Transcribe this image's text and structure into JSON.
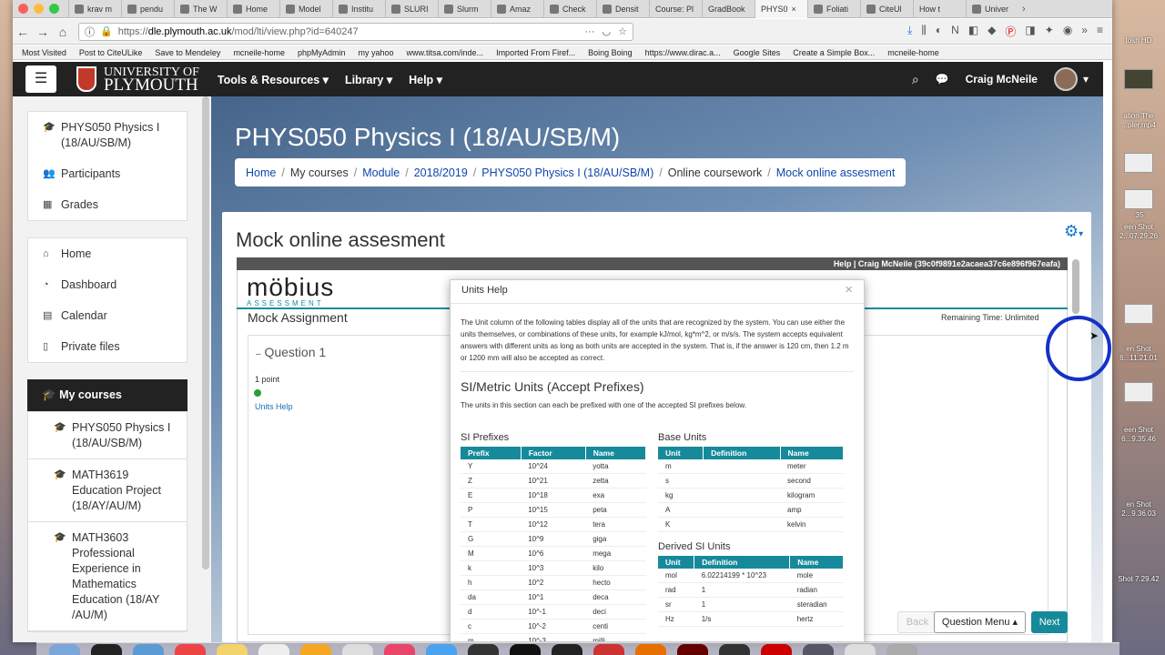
{
  "browser": {
    "tabs": [
      {
        "icon": "bookmark-icon",
        "label": "krav m"
      },
      {
        "icon": "google-icon",
        "label": "pendu"
      },
      {
        "icon": "wordpress-icon",
        "label": "The W"
      },
      {
        "icon": "moodle-icon",
        "label": "Home"
      },
      {
        "icon": "r-icon",
        "label": "Model"
      },
      {
        "icon": "institution-icon",
        "label": "Institu"
      },
      {
        "icon": "slurm-icon",
        "label": "SLURI"
      },
      {
        "icon": "slurm-icon",
        "label": "Slurm"
      },
      {
        "icon": "amazon-icon",
        "label": "Amaz"
      },
      {
        "icon": "check-icon",
        "label": "Check"
      },
      {
        "icon": "density-icon",
        "label": "Densit"
      },
      {
        "icon": "none",
        "label": "Course: Pl"
      },
      {
        "icon": "none",
        "label": "GradBook"
      },
      {
        "icon": "none",
        "label": "PHYS0"
      },
      {
        "icon": "wikipedia-icon",
        "label": "Foliati"
      },
      {
        "icon": "citeulike-icon",
        "label": "CiteUl"
      },
      {
        "icon": "none",
        "label": "How t"
      },
      {
        "icon": "moodle-icon",
        "label": "Univer"
      }
    ],
    "url_prefix": "https://",
    "url_host": "dle.plymouth.ac.uk",
    "url_path": "/mod/lti/view.php?id=640247",
    "bookmarks": [
      "Most Visited",
      "Post to CiteULike",
      "Save to Mendeley",
      "mcneile-home",
      "phpMyAdmin",
      "my yahoo",
      "www.titsa.com/inde...",
      "Imported From Firef...",
      "Boing Boing",
      "https://www.dirac.a...",
      "Google Sites",
      "Create a Simple Box...",
      "mcneile-home"
    ]
  },
  "navbar": {
    "logo_line1": "UNIVERSITY OF",
    "logo_line2": "PLYMOUTH",
    "menus": [
      "Tools & Resources",
      "Library",
      "Help"
    ],
    "user_name": "Craig McNeile"
  },
  "drawer": {
    "course_block": [
      {
        "icon": "graduation-cap-icon",
        "label": "PHYS050 Physics I (18/AU/SB/M)"
      },
      {
        "icon": "users-icon",
        "label": "Participants"
      },
      {
        "icon": "table-icon",
        "label": "Grades"
      }
    ],
    "site_block": [
      {
        "icon": "home-icon",
        "label": "Home"
      },
      {
        "icon": "dashboard-icon",
        "label": "Dashboard"
      },
      {
        "icon": "calendar-icon",
        "label": "Calendar"
      },
      {
        "icon": "file-icon",
        "label": "Private files"
      }
    ],
    "my_courses_label": "My courses",
    "my_courses": [
      {
        "icon": "graduation-cap-icon",
        "label": "PHYS050 Physics I (18/AU/SB/M)"
      },
      {
        "icon": "graduation-cap-icon",
        "label": "MATH3619 Education Project (18/AY/AU/M)"
      },
      {
        "icon": "graduation-cap-icon",
        "label": "MATH3603 Professional Experience in Mathematics Education (18/AY /AU/M)"
      }
    ]
  },
  "page": {
    "title": "PHYS050 Physics I (18/AU/SB/M)",
    "breadcrumb": [
      "Home",
      "My courses",
      "Module",
      "2018/2019",
      "PHYS050 Physics I (18/AU/SB/M)",
      "Online coursework",
      "Mock online assesment"
    ],
    "card_title": "Mock online assesment"
  },
  "mobius": {
    "header_text": "Help | Craig McNeile (39c0f9891e2acaea37c6e896f967eafa)",
    "logo_main": "möbius",
    "logo_sub": "ASSESSMENT",
    "assignment_title": "Mock Assignment",
    "remaining_time": "Remaining Time:  Unlimited",
    "question_title": "Question 1",
    "question_points": "1 point",
    "units_help_link": "Units Help",
    "back_label": "Back",
    "question_menu_label": "Question Menu ▴",
    "next_label": "Next"
  },
  "modal": {
    "title": "Units Help",
    "close": "×",
    "intro": "The Unit column of the following tables display all of the units that are recognized by the system. You can use either the units themselves, or combinations of these units, for example kJ/mol, kg*m^2, or m/s/s. The system accepts equivalent answers with different units as long as both units are accepted in the system. That is, if the answer is 120 cm, then 1.2 m or 1200 mm will also be accepted as correct.",
    "si_heading": "SI/Metric Units (Accept Prefixes)",
    "si_note": "The units in this section can each be prefixed with one of the accepted SI prefixes below.",
    "prefixes_heading": "SI Prefixes",
    "prefixes_columns": [
      "Prefix",
      "Factor",
      "Name"
    ],
    "prefixes_rows": [
      [
        "Y",
        "10^24",
        "yotta"
      ],
      [
        "Z",
        "10^21",
        "zetta"
      ],
      [
        "E",
        "10^18",
        "exa"
      ],
      [
        "P",
        "10^15",
        "peta"
      ],
      [
        "T",
        "10^12",
        "tera"
      ],
      [
        "G",
        "10^9",
        "giga"
      ],
      [
        "M",
        "10^6",
        "mega"
      ],
      [
        "k",
        "10^3",
        "kilo"
      ],
      [
        "h",
        "10^2",
        "hecto"
      ],
      [
        "da",
        "10^1",
        "deca"
      ],
      [
        "d",
        "10^-1",
        "deci"
      ],
      [
        "c",
        "10^-2",
        "centi"
      ],
      [
        "m",
        "10^-3",
        "milli"
      ]
    ],
    "base_heading": "Base Units",
    "base_columns": [
      "Unit",
      "Definition",
      "Name"
    ],
    "base_rows": [
      [
        "m",
        "",
        "meter"
      ],
      [
        "s",
        "",
        "second"
      ],
      [
        "kg",
        "",
        "kilogram"
      ],
      [
        "A",
        "",
        "amp"
      ],
      [
        "K",
        "",
        "kelvin"
      ]
    ],
    "derived_heading": "Derived SI Units",
    "derived_columns": [
      "Unit",
      "Definition",
      "Name"
    ],
    "derived_rows": [
      [
        "mol",
        "6.02214199 * 10^23",
        "mole"
      ],
      [
        "rad",
        "1",
        "radian"
      ],
      [
        "sr",
        "1",
        "steradian"
      ],
      [
        "Hz",
        "1/s",
        "hertz"
      ]
    ]
  },
  "desktop": {
    "files": [
      "tosh HD",
      "ation The ...pler.mp4",
      ".35",
      "een Shot 2...07.29.26",
      "en Shot 6...11.21.01",
      "een Shot 6...9.35.46",
      "en Shot 2...9.36.03",
      "Shot 7.29.42"
    ]
  },
  "colors": {
    "accent": "#168a9a",
    "navbar": "#222222",
    "link": "#0f47ad",
    "highlight_circle": "#1530c8"
  }
}
